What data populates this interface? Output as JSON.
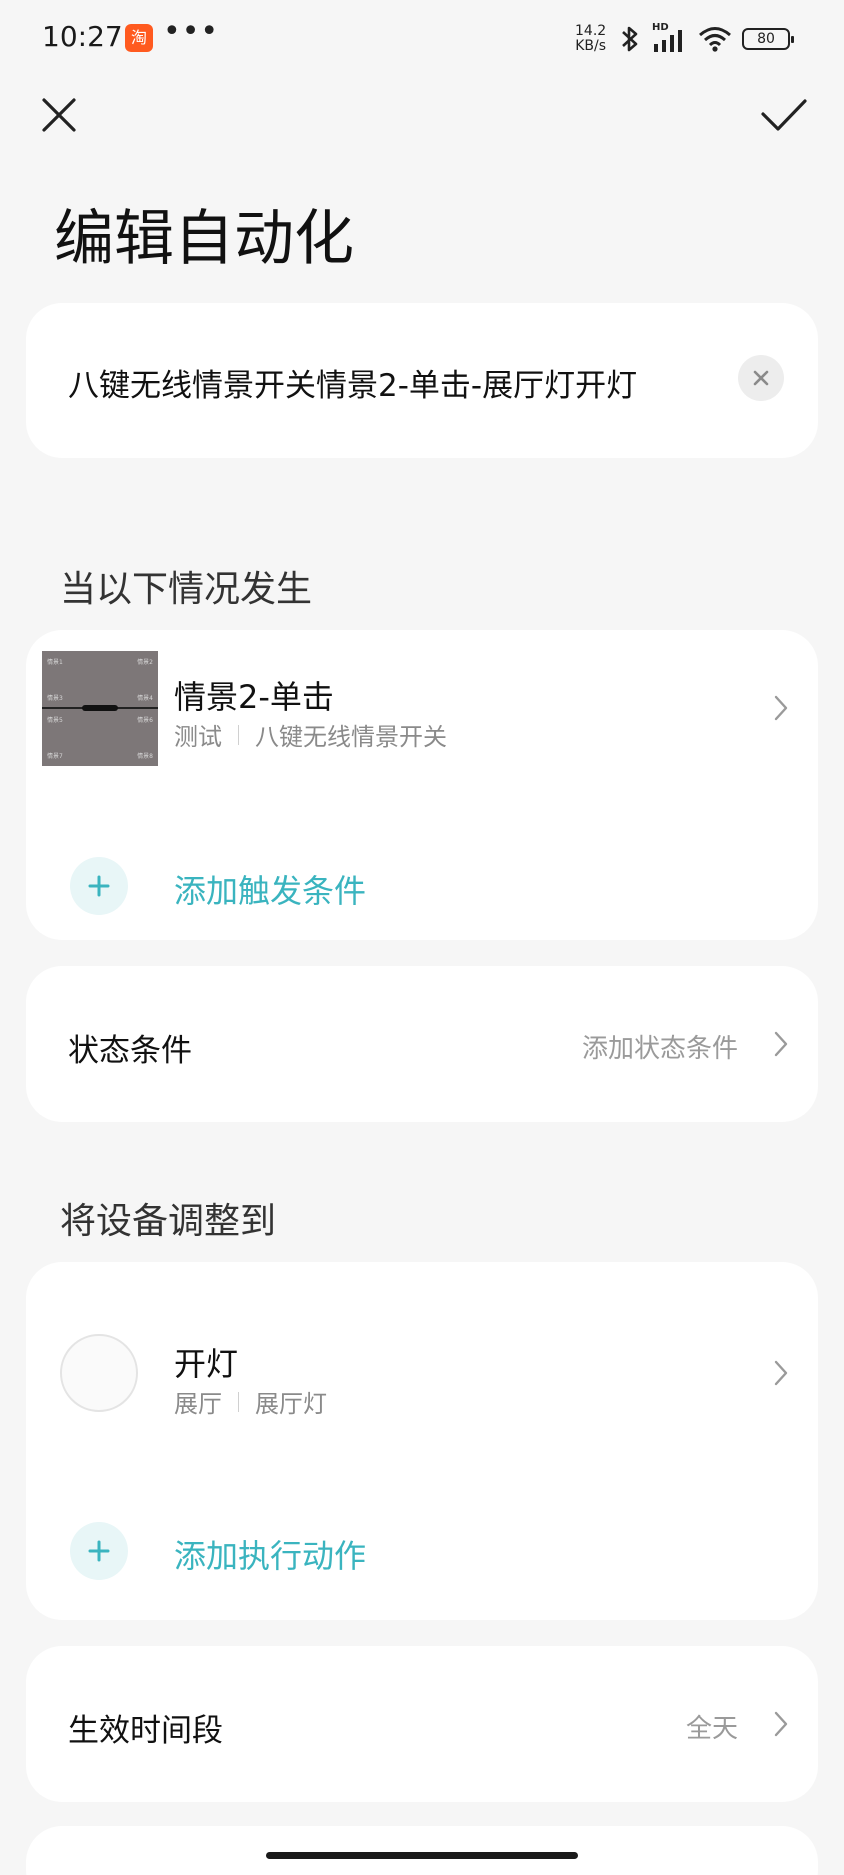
{
  "status_bar": {
    "time": "10:27",
    "app_badge": "淘",
    "more": "•••",
    "net_speed_value": "14.2",
    "net_speed_unit": "KB/s",
    "signal_label": "HD",
    "battery": "80"
  },
  "header": {
    "title": "编辑自动化"
  },
  "automation_name": "八键无线情景开关情景2-单击-展厅灯开灯",
  "trigger_section": {
    "label": "当以下情况发生",
    "thumbnail_labels": [
      "情景1",
      "情景2",
      "情景3",
      "情景4",
      "情景5",
      "情景6",
      "情景7",
      "情景8"
    ],
    "trigger": {
      "title": "情景2-单击",
      "room": "测试",
      "device": "八键无线情景开关"
    },
    "add_label": "添加触发条件"
  },
  "state_condition": {
    "label": "状态条件",
    "action_text": "添加状态条件"
  },
  "action_section": {
    "label": "将设备调整到",
    "action": {
      "title": "开灯",
      "room": "展厅",
      "device": "展厅灯"
    },
    "add_label": "添加执行动作"
  },
  "effective_time": {
    "label": "生效时间段",
    "value": "全天"
  },
  "colors": {
    "accent": "#3ab4bf",
    "background": "#f6f6f6",
    "card": "#ffffff"
  },
  "icons": {
    "close": "close-icon",
    "confirm": "check-icon",
    "clear": "clear-icon",
    "chevron": "chevron-right-icon",
    "add": "plus-icon"
  }
}
